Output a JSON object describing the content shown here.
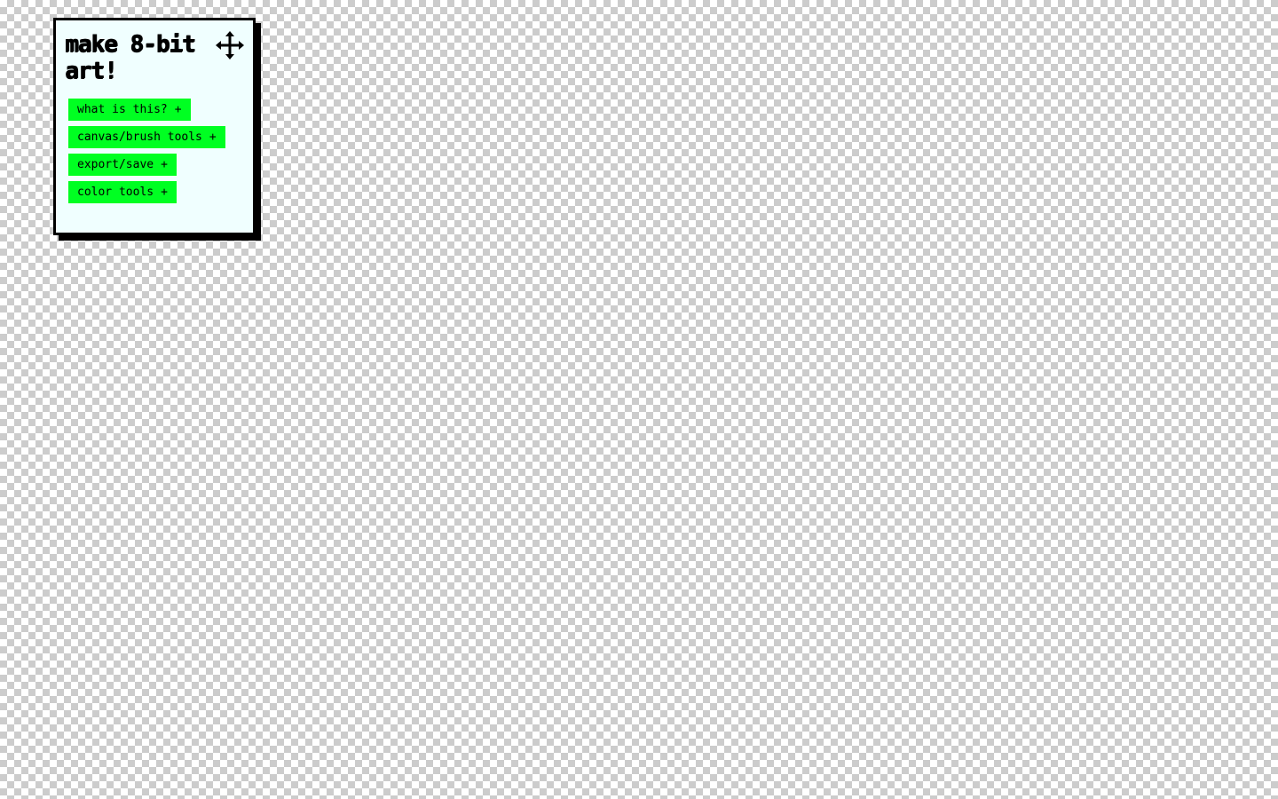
{
  "panel": {
    "title": "make 8-bit art!",
    "move_icon": "move-arrows-icon",
    "background": "#f0ffff",
    "border_color": "#000000"
  },
  "menu": {
    "button_color": "#00ff22",
    "items": [
      {
        "label": "what is this?",
        "expand_symbol": "+"
      },
      {
        "label": "canvas/brush tools",
        "expand_symbol": "+"
      },
      {
        "label": "export/save",
        "expand_symbol": "+"
      },
      {
        "label": "color tools",
        "expand_symbol": "+"
      }
    ]
  },
  "canvas": {
    "background": "transparent-checkerboard"
  }
}
